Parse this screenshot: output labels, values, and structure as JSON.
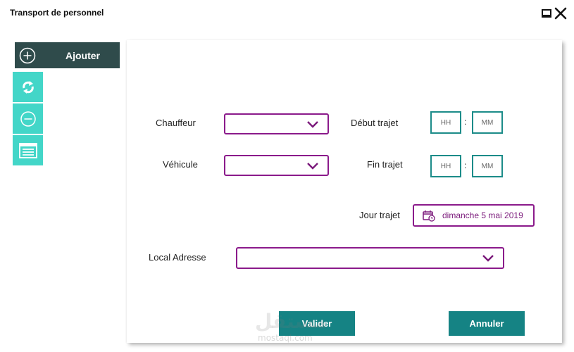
{
  "window": {
    "title": "Transport de personnel"
  },
  "toolbar": {
    "add_label": "Ajouter",
    "icons": [
      "plus-circle-icon",
      "refresh-icon",
      "minus-circle-icon",
      "list-icon"
    ]
  },
  "form": {
    "driver_label": "Chauffeur",
    "vehicle_label": "Véhicule",
    "start_label": "Début trajet",
    "end_label": "Fin trajet",
    "day_label": "Jour trajet",
    "address_label": "Local Adresse",
    "hour_placeholder": "HH",
    "minute_placeholder": "MM",
    "time_separator": ":",
    "date_value": "dimanche 5 mai 2019"
  },
  "actions": {
    "validate": "Valider",
    "cancel": "Annuler"
  },
  "watermark": {
    "arabic": "مستقل",
    "latin": "mostaql.com"
  },
  "colors": {
    "accent_purple": "#8b1a8b",
    "teal": "#158384",
    "tool_cyan": "#43d6c8",
    "dark_header": "#2f4b4b"
  }
}
